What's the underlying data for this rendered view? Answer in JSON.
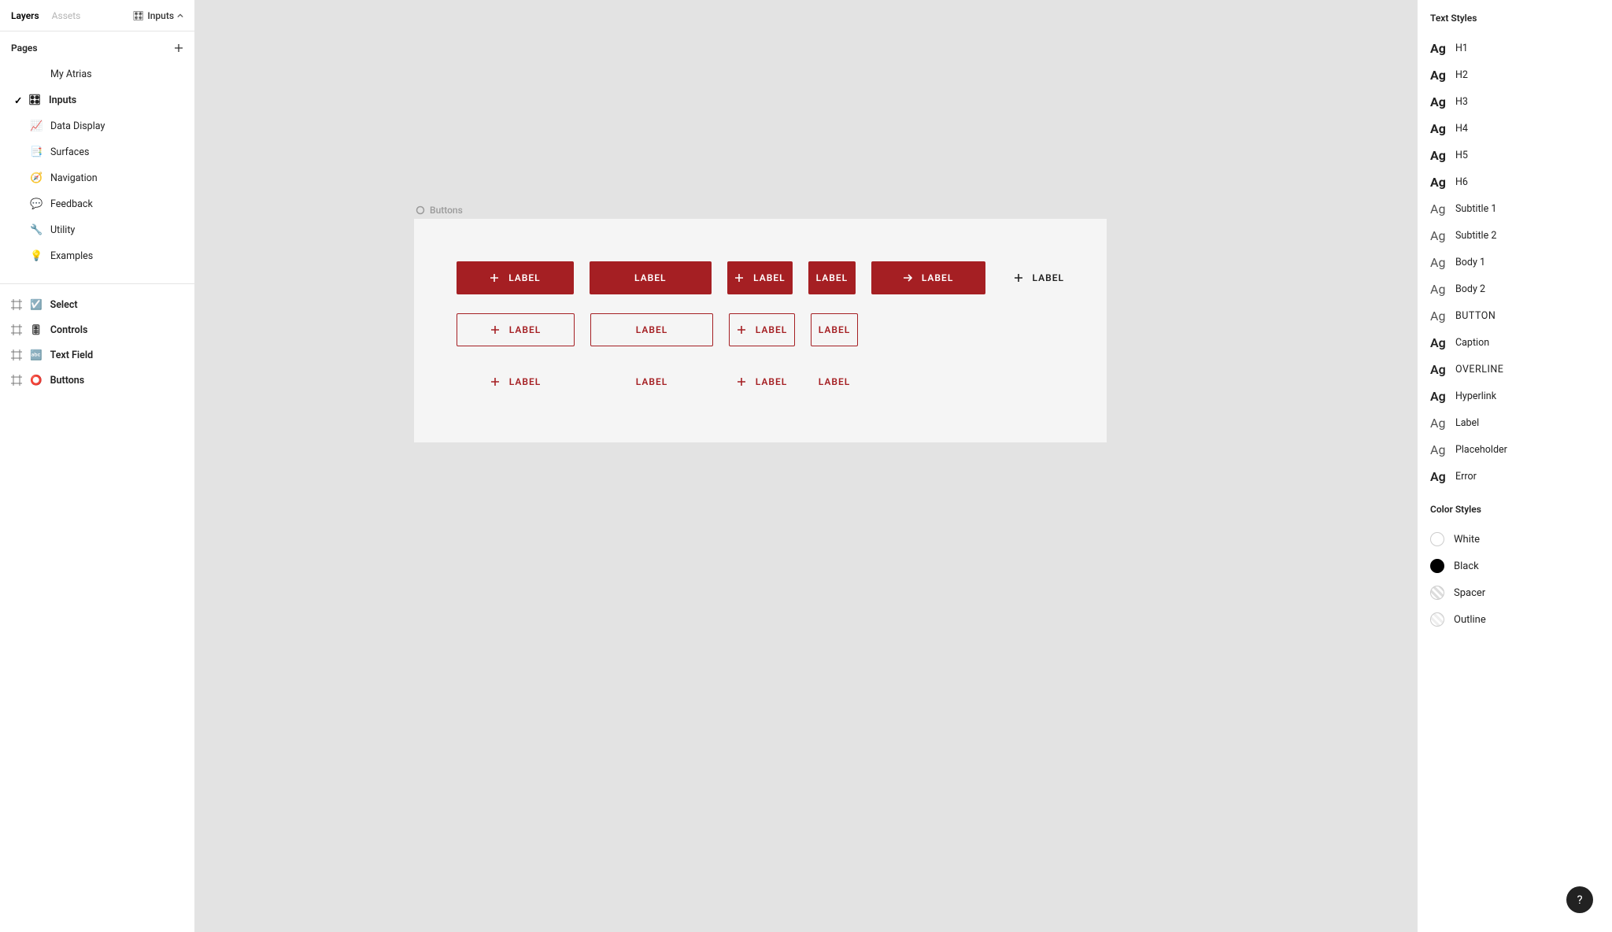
{
  "sidebar": {
    "tabs": {
      "layers": "Layers",
      "assets": "Assets"
    },
    "current_page_crumb": {
      "icon": "🎛",
      "label": "Inputs"
    },
    "pages": {
      "title": "Pages",
      "items": [
        {
          "icon": "",
          "label": "My Atrias",
          "selected": false
        },
        {
          "icon": "🎛",
          "label": "Inputs",
          "selected": true
        },
        {
          "icon": "📈",
          "label": "Data Display",
          "selected": false
        },
        {
          "icon": "📑",
          "label": "Surfaces",
          "selected": false
        },
        {
          "icon": "🧭",
          "label": "Navigation",
          "selected": false
        },
        {
          "icon": "💬",
          "label": "Feedback",
          "selected": false
        },
        {
          "icon": "🔧",
          "label": "Utility",
          "selected": false
        },
        {
          "icon": "💡",
          "label": "Examples",
          "selected": false
        }
      ]
    },
    "frames": [
      {
        "icon": "☑️",
        "label": "Select",
        "bold": true
      },
      {
        "icon": "🎚",
        "label": "Controls",
        "bold": true
      },
      {
        "icon": "🔤",
        "label": "Text Field",
        "bold": true
      },
      {
        "icon": "⭕",
        "label": "Buttons",
        "bold": true
      }
    ]
  },
  "canvas": {
    "frame_label": "Buttons",
    "button_label": "LABEL"
  },
  "rightpanel": {
    "text_styles_title": "Text Styles",
    "text_styles": [
      {
        "weight": "bold",
        "label": "H1"
      },
      {
        "weight": "bold",
        "label": "H2"
      },
      {
        "weight": "bold",
        "label": "H3"
      },
      {
        "weight": "bold",
        "label": "H4"
      },
      {
        "weight": "bold",
        "label": "H5"
      },
      {
        "weight": "bold",
        "label": "H6"
      },
      {
        "weight": "regular",
        "label": "Subtitle 1"
      },
      {
        "weight": "regular",
        "label": "Subtitle 2"
      },
      {
        "weight": "regular",
        "label": "Body 1"
      },
      {
        "weight": "regular",
        "label": "Body 2"
      },
      {
        "weight": "regular",
        "label": "BUTTON",
        "upper": true
      },
      {
        "weight": "semibold",
        "label": "Caption"
      },
      {
        "weight": "semibold",
        "label": "OVERLINE",
        "upper": true
      },
      {
        "weight": "semibold",
        "label": "Hyperlink"
      },
      {
        "weight": "regular",
        "label": "Label"
      },
      {
        "weight": "regular",
        "label": "Placeholder"
      },
      {
        "weight": "semibold",
        "label": "Error"
      }
    ],
    "color_styles_title": "Color Styles",
    "color_styles": [
      {
        "swatch": "white",
        "label": "White"
      },
      {
        "swatch": "black",
        "label": "Black"
      },
      {
        "swatch": "hatched",
        "label": "Spacer"
      },
      {
        "swatch": "hatched-light",
        "label": "Outline"
      }
    ]
  },
  "fab": {
    "label": "?"
  },
  "colors": {
    "brand": "#a51f23"
  }
}
